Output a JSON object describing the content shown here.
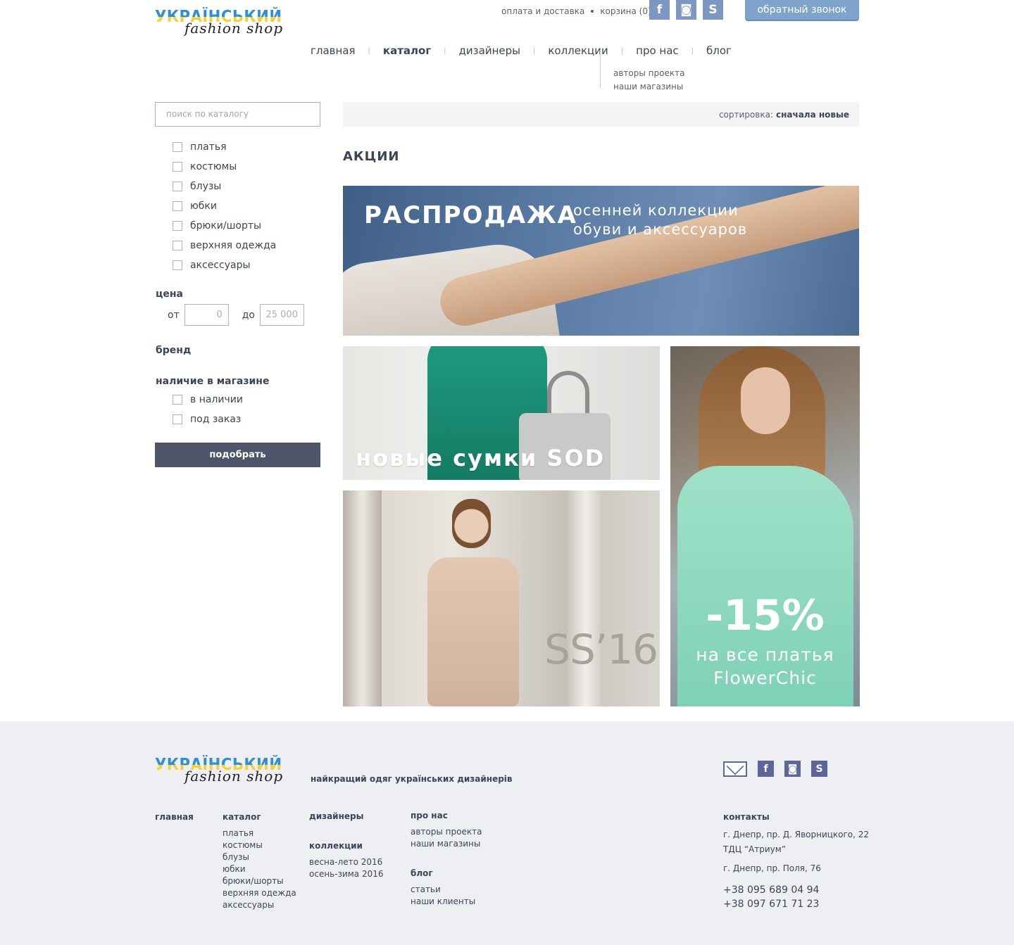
{
  "header": {
    "logo": {
      "line1": "УКРАЇНСЬКИЙ",
      "line2": "fashion shop"
    },
    "top_links": [
      "оплата и доставка",
      "корзина (0)"
    ],
    "social": [
      {
        "name": "facebook-icon",
        "glyph": "f"
      },
      {
        "name": "instagram-icon",
        "glyph": "◙"
      },
      {
        "name": "skype-icon",
        "glyph": "S"
      }
    ],
    "callback_label": "обратный звонок"
  },
  "nav": {
    "items": [
      "главная",
      "каталог",
      "дизайнеры",
      "коллекции",
      "про нас",
      "блог"
    ],
    "active": "каталог",
    "sub_items": [
      "авторы проекта",
      "наши магазины"
    ]
  },
  "sidebar": {
    "search_placeholder": "поиск по каталогу",
    "categories": [
      "платья",
      "костюмы",
      "блузы",
      "юбки",
      "брюки/шорты",
      "верхняя одежда",
      "аксессуары"
    ],
    "price_label": "цена",
    "price_from_label": "от",
    "price_from_value": "0",
    "price_to_label": "до",
    "price_to_value": "25 000",
    "brand_label": "бренд",
    "stock_label": "наличие в магазине",
    "stock_options": [
      "в наличии",
      "под заказ"
    ],
    "submit_label": "подобрать"
  },
  "content": {
    "sort_label": "сортировка:",
    "sort_value": "сначала новые",
    "section_title": "АКЦИИ",
    "banners": {
      "sale_big": "РАСПРОДАЖА",
      "sale_line1": "осенней коллекции",
      "sale_line2": "обуви и аксессуаров",
      "bags": "новые сумки SOD",
      "ss": "SS’16",
      "discount": "-15%",
      "discount_line1": "на все платья",
      "discount_line2": "FlowerChic"
    }
  },
  "footer": {
    "tagline": "найкращий одяг українських дизайнерів",
    "col_main": "главная",
    "col_catalog": {
      "title": "каталог",
      "items": [
        "платья",
        "костюмы",
        "блузы",
        "юбки",
        "брюки/шорты",
        "верхняя одежда",
        "аксессуары"
      ]
    },
    "col_designers": "дизайнеры",
    "col_collections": {
      "title": "коллекции",
      "items": [
        "весна-лето 2016",
        "осень-зима 2016"
      ]
    },
    "col_about": {
      "title": "про нас",
      "items": [
        "авторы проекта",
        "наши магазины"
      ]
    },
    "col_blog": {
      "title": "блог",
      "items": [
        "статьи",
        "наши клиенты"
      ]
    },
    "contacts": {
      "title": "контакты",
      "address1": "г. Днепр, пр. Д. Яворницкого, 22",
      "address1b": "ТДЦ “Атриум”",
      "address2": "г. Днепр, пр. Поля, 76",
      "phone1": "+38 095 689 04 94",
      "phone2": "+38 097 671 71 23"
    }
  },
  "colors": {
    "accent": "#7ea4cc",
    "dark_button": "#4d5568",
    "text": "#3c4457",
    "footer_bg": "#eeeff3"
  }
}
